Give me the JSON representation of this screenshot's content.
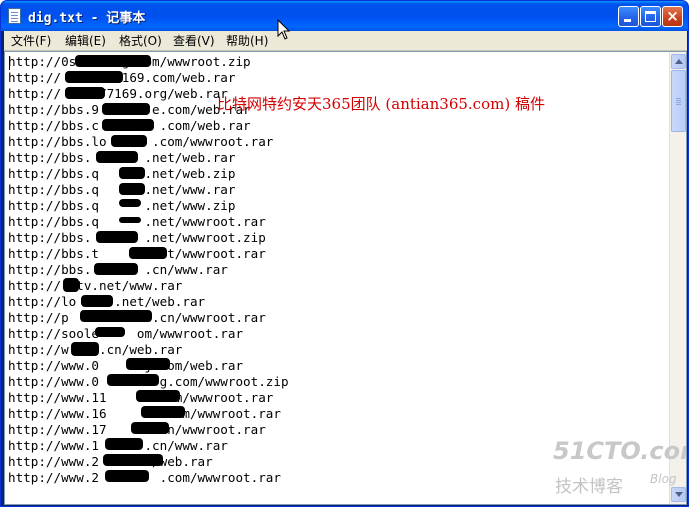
{
  "window": {
    "title": "dig.txt - 记事本",
    "close_glyph": "×",
    "icon": "notepad-icon"
  },
  "menu": [
    {
      "label": "文件(F)"
    },
    {
      "label": "编辑(E)"
    },
    {
      "label": "格式(O)"
    },
    {
      "label": "查看(V)"
    },
    {
      "label": "帮助(H)"
    }
  ],
  "editor": {
    "lines": [
      "http://0s      g.com/wwwroot.zip",
      "http://       7169.com/web.rar",
      "http://     77169.org/web.rar",
      "http://bbs.9       e.com/web.rar",
      "http://bbs.c        .com/web.rar",
      "http://bbs.lo      .com/wwwroot.rar",
      "http://bbs.       .net/web.rar",
      "http://bbs.q      .net/web.zip",
      "http://bbs.q      .net/www.rar",
      "http://bbs.q      .net/www.zip",
      "http://bbs.q      .net/wwwroot.rar",
      "http://bbs.       .net/wwwroot.zip",
      "http://bbs.t         t/wwwroot.rar",
      "http://bbs.       .cn/www.rar",
      "http://  tv.net/www.rar",
      "http://lo     .net/web.rar",
      "http://p          6.cn/wwwroot.rar",
      "http://soole     om/wwwroot.rar",
      "http://w    .cn/web.rar",
      "http://www.0      j.com/web.rar",
      "http://www.0        g.com/wwwroot.zip",
      "http://www.11      .com/wwwroot.rar",
      "http://www.16       .com/wwwroot.rar",
      "http://www.17      .cn/wwwroot.rar",
      "http://www.1      .cn/www.rar",
      "http://www.2      n/web.rar",
      "http://www.2        .com/wwwroot.rar"
    ],
    "overlay_text": "比特网特约安天365团队 (antian365.com) 稿件"
  },
  "watermark": {
    "logo": "51CTO.com",
    "subtitle": "技术博客",
    "blog": "Blog"
  },
  "colors": {
    "titlebar": "#0054e3",
    "overlay_red": "#d40000",
    "menubar": "#ece9d8"
  }
}
